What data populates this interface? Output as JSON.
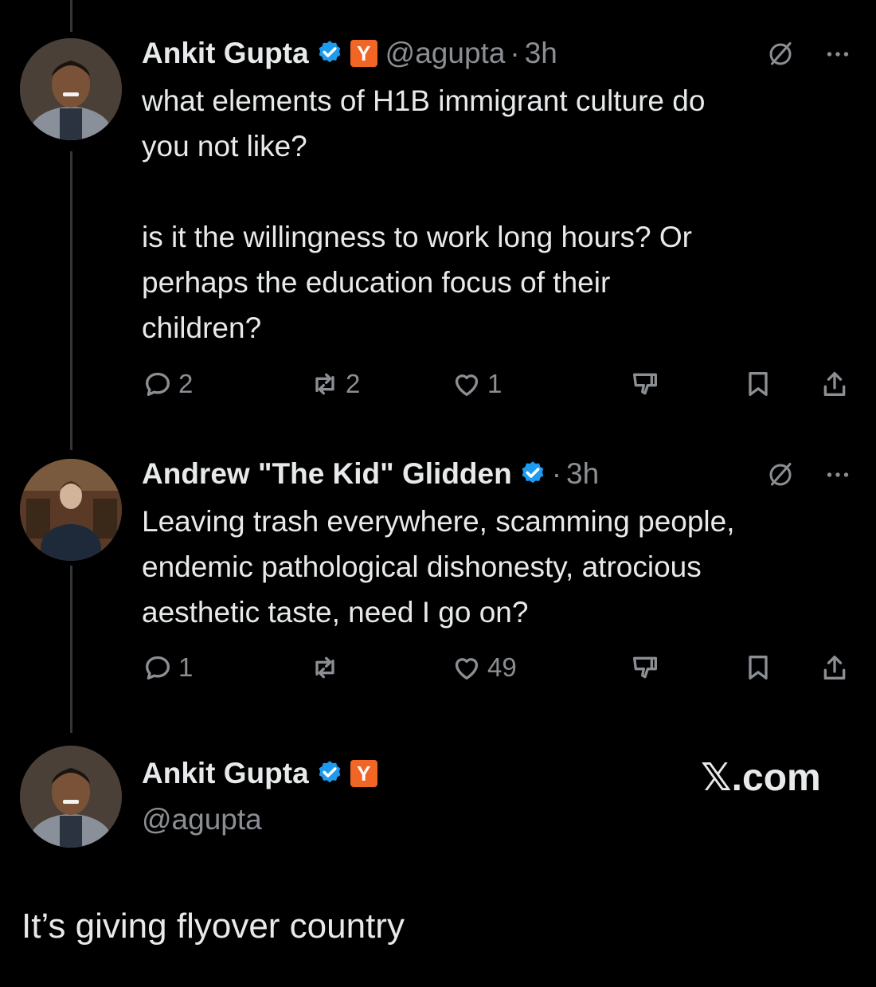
{
  "tweets": [
    {
      "name": "Ankit Gupta",
      "handle": "@agupta",
      "separator": "·",
      "time": "3h",
      "yc_badge": "Y",
      "text": "what elements of H1B immigrant culture do\nyou not like?\n\nis it the willingness to work long hours? Or\nperhaps the education focus of their\nchildren?",
      "replies": "2",
      "reposts": "2",
      "likes": "1"
    },
    {
      "name": "Andrew \"The Kid\" Glidden",
      "separator": "·",
      "time": "3h",
      "text": "Leaving trash everywhere, scamming people,\nendemic pathological dishonesty, atrocious\naesthetic taste, need I go on?",
      "replies": "1",
      "reposts": "",
      "likes": "49"
    }
  ],
  "reply_card": {
    "name": "Ankit Gupta",
    "yc_badge": "Y",
    "handle": "@agupta",
    "site": "𝕏.com",
    "text": "It’s giving flyover country"
  },
  "colors": {
    "background": "#000000",
    "text": "#e7e9ea",
    "muted": "#8b8f93",
    "verified": "#1d9bf0",
    "yc": "#f26625"
  },
  "icons": [
    "reply-icon",
    "repost-icon",
    "like-icon",
    "dislike-icon",
    "bookmark-icon",
    "share-icon",
    "grok-icon",
    "more-icon",
    "verified-icon"
  ]
}
